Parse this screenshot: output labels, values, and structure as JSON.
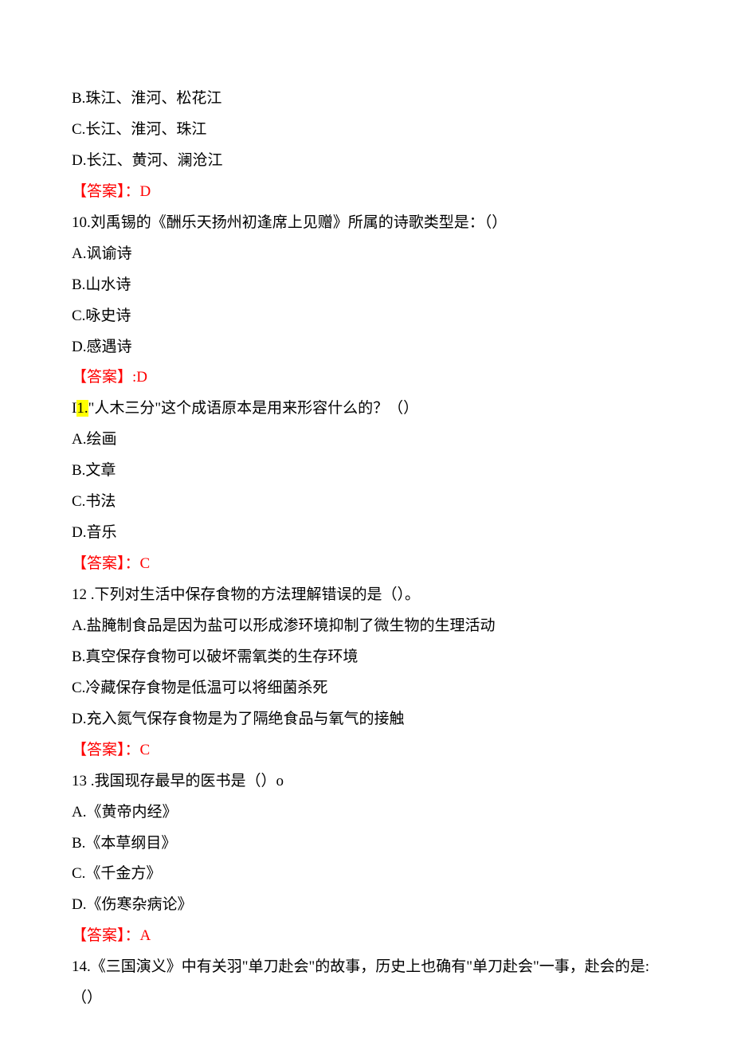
{
  "q9_continued": {
    "option_b": "B.珠江、淮河、松花江",
    "option_c": "C.长江、淮河、珠江",
    "option_d": "D.长江、黄河、澜沧江",
    "answer_label": "【答案】：",
    "answer_value": "D"
  },
  "q10": {
    "stem": "10.刘禹锡的《酬乐天扬州初逢席上见赠》所属的诗歌类型是：（）",
    "option_a": "A.讽谕诗",
    "option_b": "B.山水诗",
    "option_c": "C.咏史诗",
    "option_d": "D.感遇诗",
    "answer_label": "【答案】",
    "answer_value": ":D"
  },
  "q11": {
    "stem_prefix": "I",
    "stem_highlight": "1.",
    "stem_rest": "\"人木三分\"这个成语原本是用来形容什么的？（）",
    "option_a": "A.绘画",
    "option_b": "B.文章",
    "option_c": "C.书法",
    "option_d": "D.音乐",
    "answer_label": "【答案】：",
    "answer_value": "C"
  },
  "q12": {
    "stem": "12 .下列对生活中保存食物的方法理解错误的是（）。",
    "option_a": "A.盐腌制食品是因为盐可以形成渗环境抑制了微生物的生理活动",
    "option_b": "B.真空保存食物可以破坏需氧类的生存环境",
    "option_c": "C.冷藏保存食物是低温可以将细菌杀死",
    "option_d": "D.充入氮气保存食物是为了隔绝食品与氧气的接触",
    "answer_label": "【答案】：",
    "answer_value": "C"
  },
  "q13": {
    "stem": "13 .我国现存最早的医书是（）o",
    "option_a": "A.《黄帝内经》",
    "option_b": "B.《本草纲目》",
    "option_c": "C.《千金方》",
    "option_d": "D.《伤寒杂病论》",
    "answer_label": "【答案】：",
    "answer_value": "A"
  },
  "q14": {
    "stem_line1": "14.《三国演义》中有关羽\"单刀赴会\"的故事，历史上也确有\"单刀赴会\"一事，赴会的是:",
    "stem_line2": "（）"
  }
}
